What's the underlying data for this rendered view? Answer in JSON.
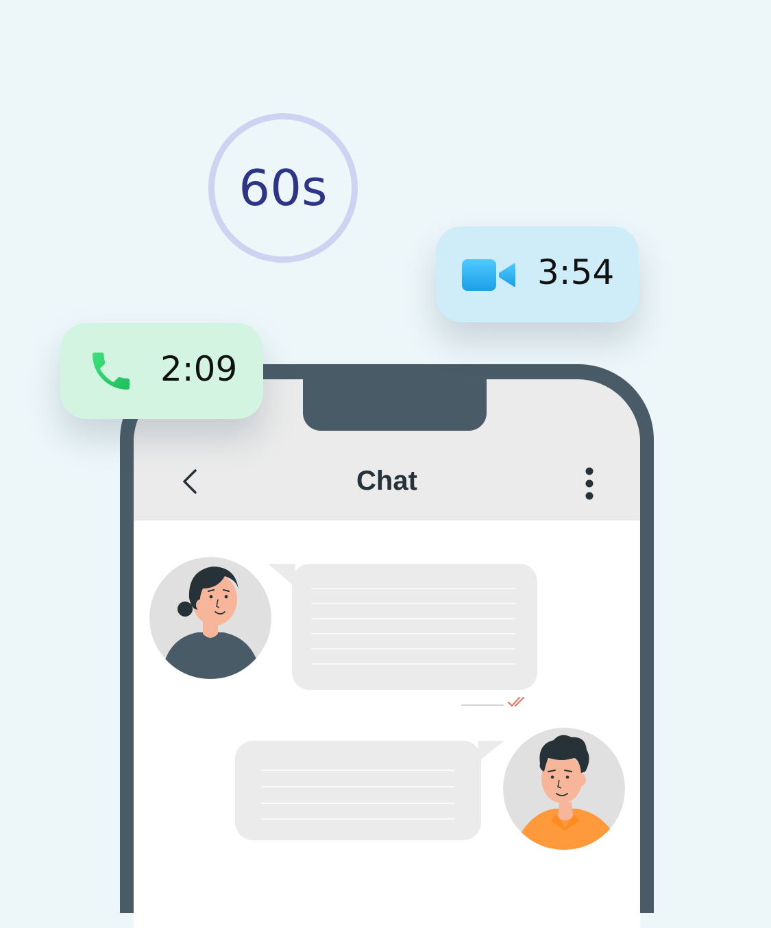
{
  "timer": {
    "label": "60s"
  },
  "video_call": {
    "duration": "3:54",
    "icon": "video-camera-icon",
    "icon_color": "#29b6f6"
  },
  "voice_call": {
    "duration": "2:09",
    "icon": "phone-icon",
    "icon_color": "#2ecc71"
  },
  "chat": {
    "title": "Chat",
    "back_icon": "chevron-left-icon",
    "menu_icon": "more-vertical-icon",
    "messages": [
      {
        "side": "left",
        "sender": "woman-avatar",
        "status": "read"
      },
      {
        "side": "right",
        "sender": "man-avatar"
      }
    ]
  },
  "colors": {
    "background": "#edf7fa",
    "timer_ring": "#cdd4f2",
    "timer_text": "#2e3586",
    "phone_frame": "#485b66",
    "header_bg": "#ebebeb",
    "bubble_bg": "#ebebeb",
    "read_ticks": "#f06a5a",
    "video_pill": "#cfecf9",
    "call_pill": "#d3f4e1"
  }
}
